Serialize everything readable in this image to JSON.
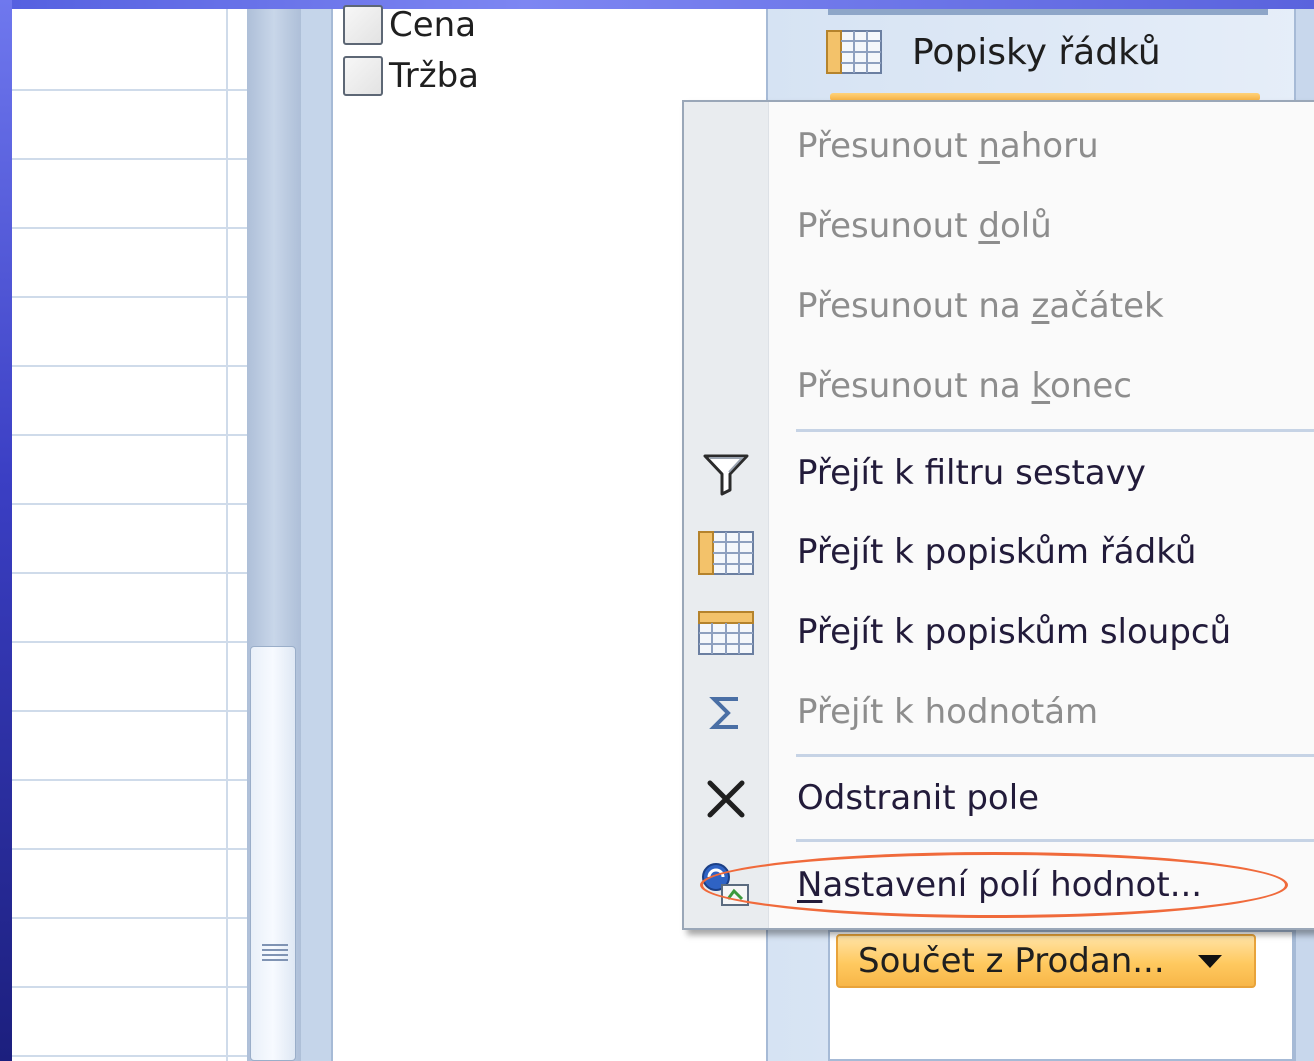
{
  "field_list": {
    "items": [
      {
        "label": "Cena",
        "checked": false
      },
      {
        "label": "Tržba",
        "checked": false
      }
    ]
  },
  "areas": {
    "row_labels_title": "Popisky řádků",
    "values_field_button": "Součet z Prodan..."
  },
  "context_menu": {
    "items": [
      {
        "id": "move-up",
        "pre": "Přesunout ",
        "key": "n",
        "post": "ahoru",
        "enabled": false,
        "icon": "none"
      },
      {
        "id": "move-down",
        "pre": "Přesunout ",
        "key": "d",
        "post": "olů",
        "enabled": false,
        "icon": "none"
      },
      {
        "id": "move-to-start",
        "pre": "Přesunout na ",
        "key": "z",
        "post": "ačátek",
        "enabled": false,
        "icon": "none"
      },
      {
        "id": "move-to-end",
        "pre": "Přesunout na ",
        "key": "k",
        "post": "onec",
        "enabled": false,
        "icon": "none"
      },
      {
        "id": "go-to-report-filter",
        "pre": "Přejít k filtru sestavy",
        "key": "",
        "post": "",
        "enabled": true,
        "icon": "filter-icon"
      },
      {
        "id": "go-to-row-labels",
        "pre": "Přejít k popiskům řádků",
        "key": "",
        "post": "",
        "enabled": true,
        "icon": "row-labels-icon"
      },
      {
        "id": "go-to-column-labels",
        "pre": "Přejít k popiskům sloupců",
        "key": "",
        "post": "",
        "enabled": true,
        "icon": "column-labels-icon"
      },
      {
        "id": "go-to-values",
        "pre": "Přejít k hodnotám",
        "key": "",
        "post": "",
        "enabled": false,
        "icon": "sigma-icon"
      },
      {
        "id": "remove-field",
        "pre": "Odstranit pole",
        "key": "",
        "post": "",
        "enabled": true,
        "icon": "remove-x-icon"
      },
      {
        "id": "value-field-settings",
        "pre": "",
        "key": "N",
        "post": "astavení polí hodnot...",
        "enabled": true,
        "icon": "field-settings-icon"
      }
    ]
  },
  "colors": {
    "highlight_ellipse": "#f06a3b",
    "field_button_orange": "#ffc95f",
    "menu_text_enabled": "#221b3a",
    "menu_text_disabled": "#8d8d8d"
  }
}
